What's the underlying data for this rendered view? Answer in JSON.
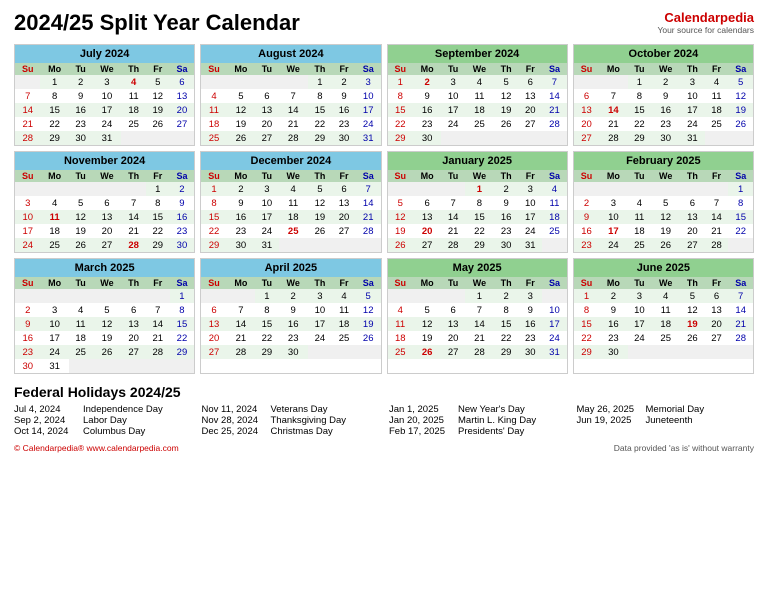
{
  "title": "2024/25 Split Year Calendar",
  "brand": {
    "name": "Calendarpedia",
    "name_part1": "Calendar",
    "name_part2": "pedia",
    "tagline": "Your source for calendars"
  },
  "months": [
    {
      "id": "july",
      "name": "July 2024",
      "class": "blue",
      "days": [
        [
          "",
          "1",
          "2",
          "3",
          "4",
          "5",
          "6"
        ],
        [
          "7",
          "8",
          "9",
          "10",
          "11",
          "12",
          "13"
        ],
        [
          "14",
          "15",
          "16",
          "17",
          "18",
          "19",
          "20"
        ],
        [
          "21",
          "22",
          "23",
          "24",
          "25",
          "26",
          "27"
        ],
        [
          "28",
          "29",
          "30",
          "31",
          "",
          "",
          ""
        ]
      ],
      "holidays": [
        4
      ]
    },
    {
      "id": "august",
      "name": "August 2024",
      "class": "blue",
      "days": [
        [
          "",
          "",
          "",
          "",
          "1",
          "2",
          "3"
        ],
        [
          "4",
          "5",
          "6",
          "7",
          "8",
          "9",
          "10"
        ],
        [
          "11",
          "12",
          "13",
          "14",
          "15",
          "16",
          "17"
        ],
        [
          "18",
          "19",
          "20",
          "21",
          "22",
          "23",
          "24"
        ],
        [
          "25",
          "26",
          "27",
          "28",
          "29",
          "30",
          "31"
        ]
      ]
    },
    {
      "id": "september",
      "name": "September 2024",
      "class": "green",
      "days": [
        [
          "1",
          "2",
          "3",
          "4",
          "5",
          "6",
          "7"
        ],
        [
          "8",
          "9",
          "10",
          "11",
          "12",
          "13",
          "14"
        ],
        [
          "15",
          "16",
          "17",
          "18",
          "19",
          "20",
          "21"
        ],
        [
          "22",
          "23",
          "24",
          "25",
          "26",
          "27",
          "28"
        ],
        [
          "29",
          "30",
          "",
          "",
          "",
          "",
          ""
        ]
      ],
      "holidays": [
        2
      ]
    },
    {
      "id": "october",
      "name": "October 2024",
      "class": "green",
      "days": [
        [
          "",
          "",
          "1",
          "2",
          "3",
          "4",
          "5"
        ],
        [
          "6",
          "7",
          "8",
          "9",
          "10",
          "11",
          "12"
        ],
        [
          "13",
          "14",
          "15",
          "16",
          "17",
          "18",
          "19"
        ],
        [
          "20",
          "21",
          "22",
          "23",
          "24",
          "25",
          "26"
        ],
        [
          "27",
          "28",
          "29",
          "30",
          "31",
          "",
          ""
        ]
      ],
      "holidays": [
        14
      ]
    },
    {
      "id": "november",
      "name": "November 2024",
      "class": "blue",
      "days": [
        [
          "",
          "",
          "",
          "",
          "",
          "1",
          "2"
        ],
        [
          "3",
          "4",
          "5",
          "6",
          "7",
          "8",
          "9"
        ],
        [
          "10",
          "11",
          "12",
          "13",
          "14",
          "15",
          "16"
        ],
        [
          "17",
          "18",
          "19",
          "20",
          "21",
          "22",
          "23"
        ],
        [
          "24",
          "25",
          "26",
          "27",
          "28",
          "29",
          "30"
        ]
      ],
      "holidays": [
        11,
        28
      ]
    },
    {
      "id": "december",
      "name": "December 2024",
      "class": "blue",
      "days": [
        [
          "1",
          "2",
          "3",
          "4",
          "5",
          "6",
          "7"
        ],
        [
          "8",
          "9",
          "10",
          "11",
          "12",
          "13",
          "14"
        ],
        [
          "15",
          "16",
          "17",
          "18",
          "19",
          "20",
          "21"
        ],
        [
          "22",
          "23",
          "24",
          "25",
          "26",
          "27",
          "28"
        ],
        [
          "29",
          "30",
          "31",
          "",
          "",
          "",
          ""
        ]
      ],
      "holidays": [
        25
      ]
    },
    {
      "id": "january",
      "name": "January 2025",
      "class": "green",
      "days": [
        [
          "",
          "",
          "",
          "1",
          "2",
          "3",
          "4"
        ],
        [
          "5",
          "6",
          "7",
          "8",
          "9",
          "10",
          "11"
        ],
        [
          "12",
          "13",
          "14",
          "15",
          "16",
          "17",
          "18"
        ],
        [
          "19",
          "20",
          "21",
          "22",
          "23",
          "24",
          "25"
        ],
        [
          "26",
          "27",
          "28",
          "29",
          "30",
          "31",
          ""
        ]
      ],
      "holidays": [
        1,
        20
      ]
    },
    {
      "id": "february",
      "name": "February 2025",
      "class": "green",
      "days": [
        [
          "",
          "",
          "",
          "",
          "",
          "",
          "1"
        ],
        [
          "2",
          "3",
          "4",
          "5",
          "6",
          "7",
          "8"
        ],
        [
          "9",
          "10",
          "11",
          "12",
          "13",
          "14",
          "15"
        ],
        [
          "16",
          "17",
          "18",
          "19",
          "20",
          "21",
          "22"
        ],
        [
          "23",
          "24",
          "25",
          "26",
          "27",
          "28",
          ""
        ]
      ],
      "holidays": [
        17
      ]
    },
    {
      "id": "march",
      "name": "March 2025",
      "class": "blue",
      "days": [
        [
          "",
          "",
          "",
          "",
          "",
          "",
          "1"
        ],
        [
          "2",
          "3",
          "4",
          "5",
          "6",
          "7",
          "8"
        ],
        [
          "9",
          "10",
          "11",
          "12",
          "13",
          "14",
          "15"
        ],
        [
          "16",
          "17",
          "18",
          "19",
          "20",
          "21",
          "22"
        ],
        [
          "23",
          "24",
          "25",
          "26",
          "27",
          "28",
          "29"
        ],
        [
          "30",
          "31",
          "",
          "",
          "",
          "",
          ""
        ]
      ]
    },
    {
      "id": "april",
      "name": "April 2025",
      "class": "blue",
      "days": [
        [
          "",
          "",
          "1",
          "2",
          "3",
          "4",
          "5"
        ],
        [
          "6",
          "7",
          "8",
          "9",
          "10",
          "11",
          "12"
        ],
        [
          "13",
          "14",
          "15",
          "16",
          "17",
          "18",
          "19"
        ],
        [
          "20",
          "21",
          "22",
          "23",
          "24",
          "25",
          "26"
        ],
        [
          "27",
          "28",
          "29",
          "30",
          "",
          "",
          ""
        ]
      ]
    },
    {
      "id": "may",
      "name": "May 2025",
      "class": "green",
      "days": [
        [
          "",
          "",
          "",
          "1",
          "2",
          "3",
          ""
        ],
        [
          "4",
          "5",
          "6",
          "7",
          "8",
          "9",
          "10"
        ],
        [
          "11",
          "12",
          "13",
          "14",
          "15",
          "16",
          "17"
        ],
        [
          "18",
          "19",
          "20",
          "21",
          "22",
          "23",
          "24"
        ],
        [
          "25",
          "26",
          "27",
          "28",
          "29",
          "30",
          "31"
        ]
      ],
      "holidays": [
        26
      ]
    },
    {
      "id": "june",
      "name": "June 2025",
      "class": "green",
      "days": [
        [
          "1",
          "2",
          "3",
          "4",
          "5",
          "6",
          "7"
        ],
        [
          "8",
          "9",
          "10",
          "11",
          "12",
          "13",
          "14"
        ],
        [
          "15",
          "16",
          "17",
          "18",
          "19",
          "20",
          "21"
        ],
        [
          "22",
          "23",
          "24",
          "25",
          "26",
          "27",
          "28"
        ],
        [
          "29",
          "30",
          "",
          "",
          "",
          "",
          ""
        ]
      ],
      "holidays": [
        19
      ]
    }
  ],
  "weekdays": [
    "Su",
    "Mo",
    "Tu",
    "We",
    "Th",
    "Fr",
    "Sa"
  ],
  "holidays": [
    {
      "date": "Jul 4, 2024",
      "name": "Independence Day"
    },
    {
      "date": "Sep 2, 2024",
      "name": "Labor Day"
    },
    {
      "date": "Oct 14, 2024",
      "name": "Columbus Day"
    },
    {
      "date": "Nov 11, 2024",
      "name": "Veterans Day"
    },
    {
      "date": "Nov 28, 2024",
      "name": "Thanksgiving Day"
    },
    {
      "date": "Dec 25, 2024",
      "name": "Christmas Day"
    },
    {
      "date": "Jan 1, 2025",
      "name": "New Year's Day"
    },
    {
      "date": "Jan 20, 2025",
      "name": "Martin L. King Day"
    },
    {
      "date": "Feb 17, 2025",
      "name": "Presidents' Day"
    },
    {
      "date": "May 26, 2025",
      "name": "Memorial Day"
    },
    {
      "date": "Jun 19, 2025",
      "name": "Juneteenth"
    }
  ],
  "holidays_title": "Federal Holidays 2024/25",
  "footer_left": "© Calendarpedia®   www.calendarpedia.com",
  "footer_right": "Data provided 'as is' without warranty"
}
